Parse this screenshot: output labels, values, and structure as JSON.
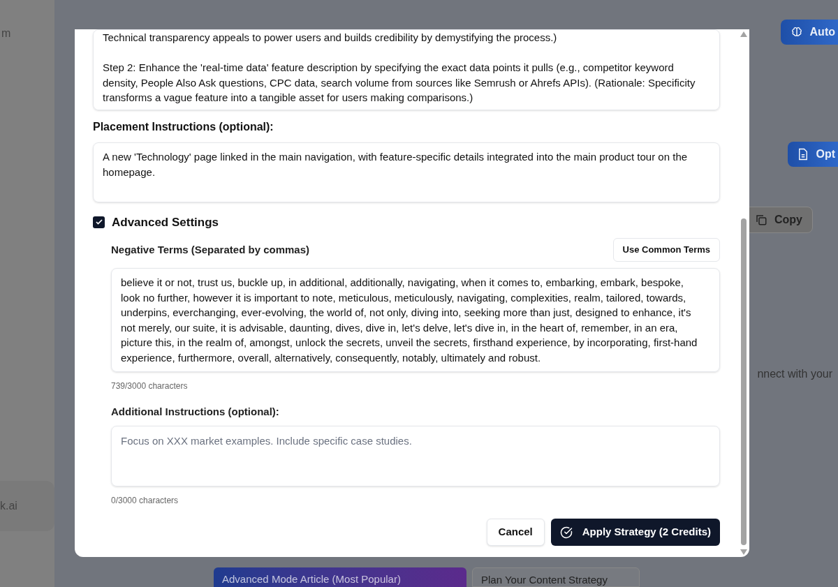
{
  "background": {
    "sidebar_text": "m",
    "sidebar_card": "k.ai",
    "buttons": [
      {
        "label": "Auto",
        "kind": "gradient"
      },
      {
        "label": "Opt",
        "kind": "gradient"
      },
      {
        "label": "Copy",
        "kind": "outline"
      }
    ],
    "body_text": "nnect with your",
    "cards": [
      {
        "label": "Advanced Mode Article (Most Popular)",
        "kind": "gradient"
      },
      {
        "label": "Plan Your Content Strategy",
        "kind": "outline"
      }
    ]
  },
  "dialog": {
    "strategy_text": "Technical transparency appeals to power users and builds credibility by demystifying the process.)\n\nStep 2: Enhance the 'real-time data' feature description by specifying the exact data points it pulls (e.g., competitor keyword density, People Also Ask questions, CPC data, search volume from sources like Semrush or Ahrefs APIs). (Rationale: Specificity transforms a vague feature into a tangible asset for users making comparisons.)",
    "placement": {
      "label": "Placement Instructions (optional):",
      "value": "A new 'Technology' page linked in the main navigation, with feature-specific details integrated into the main product tour on the homepage."
    },
    "advanced_settings": {
      "label": "Advanced Settings",
      "checked": true
    },
    "negative_terms": {
      "label": "Negative Terms (Separated by commas)",
      "button": "Use Common Terms",
      "value": "believe it or not, trust us, buckle up, in additional, additionally, navigating, when it comes to, embarking, embark, bespoke, look no further, however it is important to note, meticulous, meticulously, navigating, complexities, realm, tailored, towards, underpins, everchanging, ever-evolving, the world of, not only, diving into, seeking more than just, designed to enhance, it's not merely, our suite, it is advisable, daunting, dives, dive in, let's delve, let's dive in, in the heart of, remember, in an era, picture this, in the realm of, amongst, unlock the secrets, unveil the secrets, firsthand experience, by incorporating, first-hand experience, furthermore, overall, alternatively, consequently, notably, ultimately and robust.",
      "count": "739/3000 characters"
    },
    "additional": {
      "label": "Additional Instructions (optional):",
      "placeholder": "Focus on XXX market examples. Include specific case studies.",
      "count": "0/3000 characters"
    },
    "cancel": "Cancel",
    "apply": "Apply Strategy (2 Credits)"
  }
}
